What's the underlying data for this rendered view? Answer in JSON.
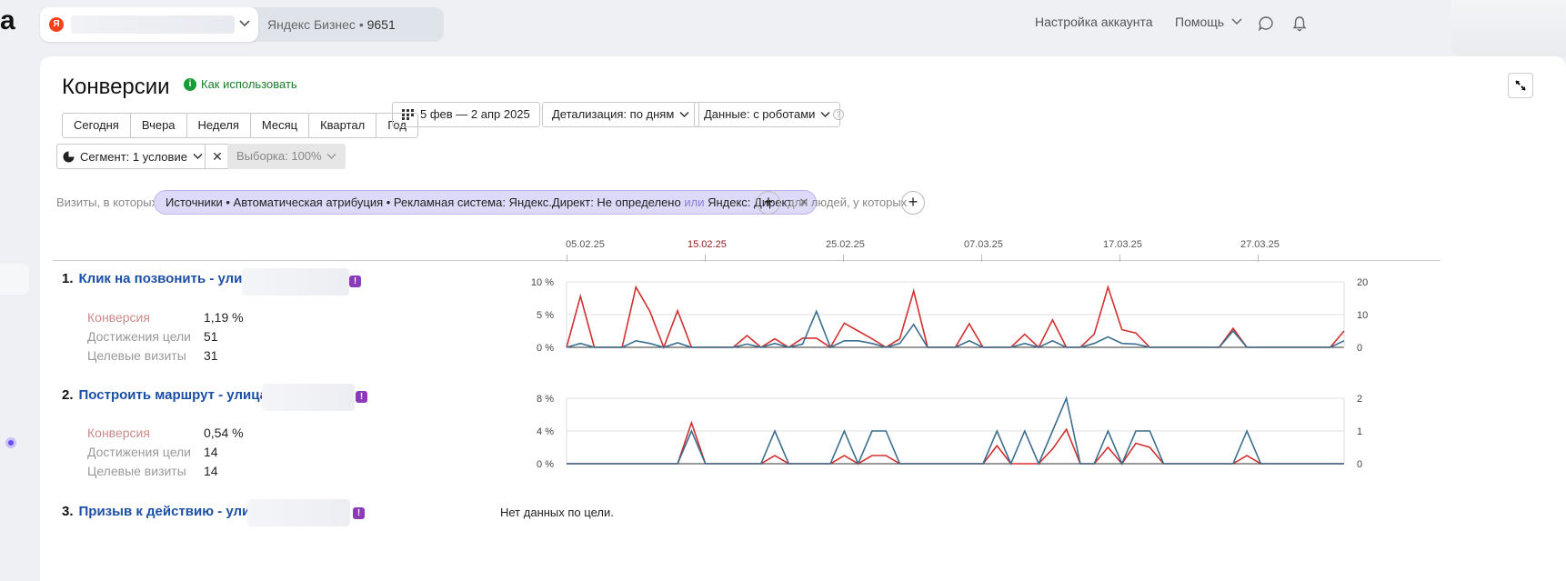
{
  "topbar": {
    "counter_badge": "Я",
    "counter_label": "Яндекс Бизнес",
    "counter_sep": "•",
    "counter_id": "9651",
    "account_settings": "Настройка аккаунта",
    "help": "Помощь"
  },
  "page": {
    "title": "Конверсии",
    "how_to_use": "Как использовать"
  },
  "periods": [
    "Сегодня",
    "Вчера",
    "Неделя",
    "Месяц",
    "Квартал",
    "Год"
  ],
  "date_range": "5 фев — 2 апр 2025",
  "detail": "Детализация: по дням",
  "data_mode": "Данные: с роботами",
  "segment": "Сегмент: 1 условие",
  "sample": "Выборка: 100%",
  "filter": {
    "visits_label": "Визиты, в которых",
    "chip_main": "Источники • Автоматическая атрибуция • Рекламная система: Яндекс.Директ: Не определено",
    "chip_or": "или",
    "chip_tail": "Яндекс: Директ",
    "people_label": "для людей, у которых"
  },
  "date_axis": [
    "05.02.25",
    "15.02.25",
    "25.02.25",
    "07.03.25",
    "17.03.25",
    "27.03.25"
  ],
  "colors": {
    "conversion": "#d0302f",
    "visits": "#3c6e8e",
    "link": "#1c4fa6",
    "warn": "#8b3ab8"
  },
  "goals": [
    {
      "num": "1.",
      "title": "Клик на позвонить - улица",
      "conv_label": "Конверсия",
      "conv": "1,19 %",
      "reach_label": "Достижения цели",
      "reach": "51",
      "visits_label": "Целевые визиты",
      "visits": "31"
    },
    {
      "num": "2.",
      "title": "Построить маршрут - улица",
      "conv_label": "Конверсия",
      "conv": "0,54 %",
      "reach_label": "Достижения цели",
      "reach": "14",
      "visits_label": "Целевые визиты",
      "visits": "14"
    },
    {
      "num": "3.",
      "title": "Призыв к действию - улиц",
      "no_data": "Нет данных по цели."
    }
  ],
  "chart_data": [
    {
      "type": "line",
      "x": [
        "05.02",
        "06.02",
        "07.02",
        "08.02",
        "09.02",
        "10.02",
        "11.02",
        "12.02",
        "13.02",
        "14.02",
        "15.02",
        "16.02",
        "17.02",
        "18.02",
        "19.02",
        "20.02",
        "21.02",
        "22.02",
        "23.02",
        "24.02",
        "25.02",
        "26.02",
        "27.02",
        "28.02",
        "01.03",
        "02.03",
        "03.03",
        "04.03",
        "05.03",
        "06.03",
        "07.03",
        "08.03",
        "09.03",
        "10.03",
        "11.03",
        "12.03",
        "13.03",
        "14.03",
        "15.03",
        "16.03",
        "17.03",
        "18.03",
        "19.03",
        "20.03",
        "21.03",
        "22.03",
        "23.03",
        "24.03",
        "25.03",
        "26.03",
        "27.03",
        "28.03",
        "29.03",
        "30.03",
        "31.03",
        "01.04",
        "02.04"
      ],
      "y_left_ticks": [
        "0 %",
        "5 %",
        "10 %"
      ],
      "y_right_ticks": [
        "0",
        "10",
        "20"
      ],
      "ylim_left": [
        0,
        10
      ],
      "ylim_right": [
        0,
        20
      ],
      "series": [
        {
          "values": [
            0,
            7.8,
            0,
            0,
            0,
            9.2,
            5.5,
            0,
            5.6,
            0,
            0,
            0,
            0,
            1.8,
            0,
            1.3,
            0,
            1.4,
            1.4,
            0,
            3.7,
            2.5,
            1.3,
            0,
            1.3,
            8.6,
            0,
            0,
            0,
            3.6,
            0,
            0,
            0,
            2,
            0,
            4.2,
            0,
            0,
            2,
            9.2,
            2.7,
            2.2,
            0,
            0,
            0,
            0,
            0,
            0,
            2.9,
            0,
            0,
            0,
            0,
            0,
            0,
            0,
            2.5
          ]
        },
        {
          "values": [
            0,
            0.6,
            0,
            0,
            0,
            1,
            0.6,
            0,
            0.7,
            0,
            0,
            0,
            0,
            0.5,
            0,
            0.6,
            0,
            0.5,
            5.5,
            0,
            1,
            1,
            0.6,
            0,
            0.6,
            3.5,
            0,
            0,
            0,
            1,
            0,
            0,
            0,
            0.6,
            0,
            1,
            0,
            0,
            0.6,
            1.6,
            0.6,
            0.5,
            0,
            0,
            0,
            0,
            0,
            0,
            2.5,
            0,
            0,
            0,
            0,
            0,
            0,
            0,
            1
          ]
        }
      ]
    },
    {
      "type": "line",
      "x": [
        "05.02",
        "06.02",
        "07.02",
        "08.02",
        "09.02",
        "10.02",
        "11.02",
        "12.02",
        "13.02",
        "14.02",
        "15.02",
        "16.02",
        "17.02",
        "18.02",
        "19.02",
        "20.02",
        "21.02",
        "22.02",
        "23.02",
        "24.02",
        "25.02",
        "26.02",
        "27.02",
        "28.02",
        "01.03",
        "02.03",
        "03.03",
        "04.03",
        "05.03",
        "06.03",
        "07.03",
        "08.03",
        "09.03",
        "10.03",
        "11.03",
        "12.03",
        "13.03",
        "14.03",
        "15.03",
        "16.03",
        "17.03",
        "18.03",
        "19.03",
        "20.03",
        "21.03",
        "22.03",
        "23.03",
        "24.03",
        "25.03",
        "26.03",
        "27.03",
        "28.03",
        "29.03",
        "30.03",
        "31.03",
        "01.04",
        "02.04"
      ],
      "y_left_ticks": [
        "0 %",
        "4 %",
        "8 %"
      ],
      "y_right_ticks": [
        "0",
        "1",
        "2"
      ],
      "ylim_left": [
        0,
        8
      ],
      "ylim_right": [
        0,
        2
      ],
      "series": [
        {
          "values": [
            0,
            0,
            0,
            0,
            0,
            0,
            0,
            0,
            0,
            5,
            0,
            0,
            0,
            0,
            0,
            1,
            0,
            0,
            0,
            0,
            1,
            0,
            1,
            1,
            0,
            0,
            0,
            0,
            0,
            0,
            0,
            2.2,
            0,
            0,
            0,
            1.8,
            4.2,
            0,
            0,
            2,
            0,
            2.5,
            2,
            0,
            0,
            0,
            0,
            0,
            0,
            1,
            0,
            0,
            0,
            0,
            0,
            0,
            0
          ]
        },
        {
          "values": [
            0,
            0,
            0,
            0,
            0,
            0,
            0,
            0,
            0,
            4,
            0,
            0,
            0,
            0,
            0,
            4,
            0,
            0,
            0,
            0,
            4,
            0,
            4,
            4,
            0,
            0,
            0,
            0,
            0,
            0,
            0,
            4,
            0,
            4,
            0,
            4,
            8,
            0,
            0,
            4,
            0,
            4,
            4,
            0,
            0,
            0,
            0,
            0,
            0,
            4,
            0,
            0,
            0,
            0,
            0,
            0,
            0
          ]
        }
      ]
    }
  ]
}
